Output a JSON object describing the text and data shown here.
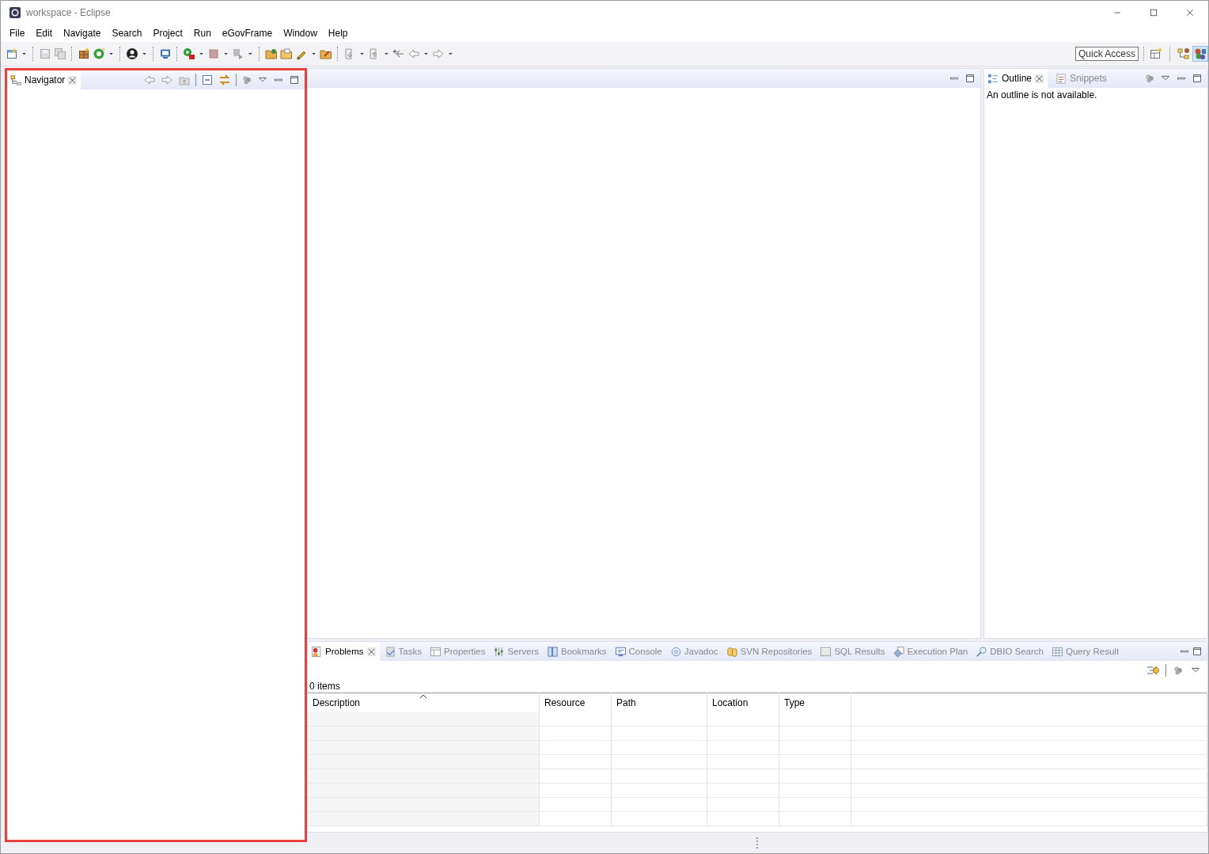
{
  "window": {
    "title": "workspace - Eclipse"
  },
  "menu": [
    "File",
    "Edit",
    "Navigate",
    "Search",
    "Project",
    "Run",
    "eGovFrame",
    "Window",
    "Help"
  ],
  "quick_access": {
    "label": "Quick Access"
  },
  "navigator": {
    "highlighted": true,
    "tabs": [
      {
        "label": "Navigator",
        "selected": true
      }
    ]
  },
  "outline": {
    "tabs": [
      {
        "label": "Outline",
        "selected": true
      },
      {
        "label": "Snippets",
        "selected": false
      }
    ],
    "message": "An outline is not available."
  },
  "bottom_panel": {
    "tabs": [
      {
        "label": "Problems",
        "selected": true
      },
      {
        "label": "Tasks",
        "selected": false
      },
      {
        "label": "Properties",
        "selected": false
      },
      {
        "label": "Servers",
        "selected": false
      },
      {
        "label": "Bookmarks",
        "selected": false
      },
      {
        "label": "Console",
        "selected": false
      },
      {
        "label": "Javadoc",
        "selected": false
      },
      {
        "label": "SVN Repositories",
        "selected": false
      },
      {
        "label": "SQL Results",
        "selected": false
      },
      {
        "label": "Execution Plan",
        "selected": false
      },
      {
        "label": "DBIO Search",
        "selected": false
      },
      {
        "label": "Query Result",
        "selected": false
      }
    ],
    "count": "0 items",
    "columns": [
      {
        "label": "Description",
        "sorted": true
      },
      {
        "label": "Resource",
        "sorted": false
      },
      {
        "label": "Path",
        "sorted": false
      },
      {
        "label": "Location",
        "sorted": false
      },
      {
        "label": "Type",
        "sorted": false
      }
    ]
  }
}
